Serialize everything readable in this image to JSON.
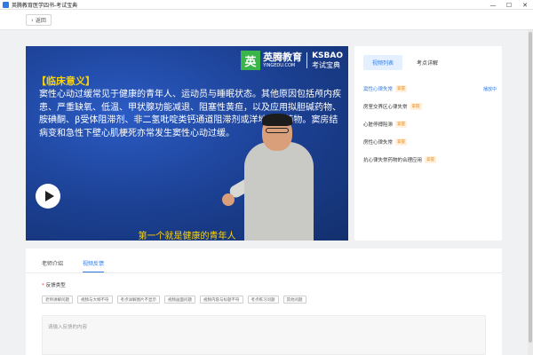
{
  "window": {
    "title": "英腾教育医学四书-考试宝典",
    "minimize": "—",
    "maximize": "☐",
    "close": "✕"
  },
  "topbar": {
    "back_label": "返回"
  },
  "video": {
    "brand_cn": "英腾教育",
    "brand_en": "YINGEDU.COM",
    "brand_logo_char": "英",
    "brand_ks": "KSBAO",
    "brand_ks_cn": "考试宝典",
    "heading": "【临床意义】",
    "body_text": "窦性心动过缓常见于健康的青年人、运动员与睡眠状态。其他原因包括颅内疾患、严重缺氧、低温、甲状腺功能减退、阻塞性黄疸，以及应用拟胆碱药物、胺碘酮、β受体阻滞剂、非二氢吡啶类钙通道阻滞剂或洋地黄等药物。窦房结病变和急性下壁心肌梗死亦常发生窦性心动过缓。",
    "subtitle": "第一个就是健康的青年人",
    "play_icon": "play-icon"
  },
  "side_panel": {
    "tabs": [
      {
        "label": "视频列表",
        "active": true
      },
      {
        "label": "考点详解",
        "active": false
      }
    ],
    "items": [
      {
        "label": "窦性心律失常",
        "badge": "掌握",
        "playing": "播放中"
      },
      {
        "label": "房室交界区心律失常",
        "badge": "掌握"
      },
      {
        "label": "心脏停搏阻滞",
        "badge": "掌握"
      },
      {
        "label": "房性心律失常",
        "badge": "掌握"
      },
      {
        "label": "抗心律失常药物的合理应用",
        "badge": "掌握"
      }
    ]
  },
  "bottom": {
    "tabs": [
      {
        "label": "老师介绍",
        "active": false
      },
      {
        "label": "视频反馈",
        "active": true
      }
    ],
    "feedback_label": "反馈类型",
    "required_mark": "*",
    "chips": [
      "老师讲解问题",
      "视频与大纲不符",
      "考点详解图片不显示",
      "视频画面问题",
      "视频内容与标题不符",
      "考点练习问题",
      "其他问题"
    ],
    "textarea_placeholder": "请输入反馈的内容"
  },
  "colors": {
    "accent": "#2f7ae5",
    "video_bg": "#1b3f90",
    "video_heading": "#ffd400",
    "badge_text": "#f08c1e",
    "brand_green": "#3bb44a"
  }
}
